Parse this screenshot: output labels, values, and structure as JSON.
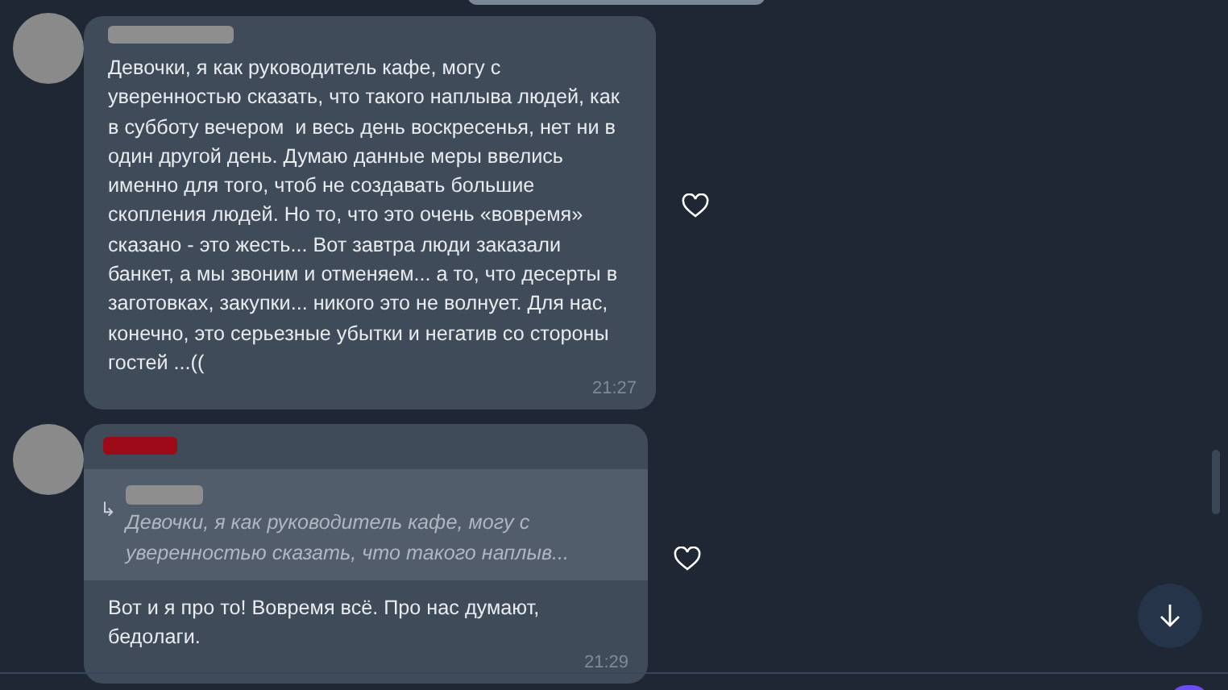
{
  "messages": [
    {
      "color": "#8e8e8e",
      "text": "Девочки, я как руководитель кафе, могу с уверенностью сказать, что такого наплыва людей, как в субботу вечером  и весь день воскресенья, нет ни в один другой день. Думаю данные меры ввелись именно для того, чтоб не создавать большие скопления людей. Но то, что это очень «вовремя» сказано - это жесть... Вот завтра люди заказали банкет, а мы звоним и отменяем... а то, что десерты в заготовках, закупки... никого это не волнует. Для нас, конечно, это серьезные убытки и негатив со стороны гостей ...((",
      "time": "21:27",
      "liked": false
    },
    {
      "color": "#9b0a16",
      "reply": {
        "arrow": "↳",
        "color": "#8e8e8e",
        "text": "Девочки, я как руководитель кафе, могу с уверенностью сказать, что такого наплыв..."
      },
      "text": "Вот и я про то! Вовремя всё. Про нас думают, бедолаги.",
      "time": "21:29",
      "liked": false
    }
  ]
}
